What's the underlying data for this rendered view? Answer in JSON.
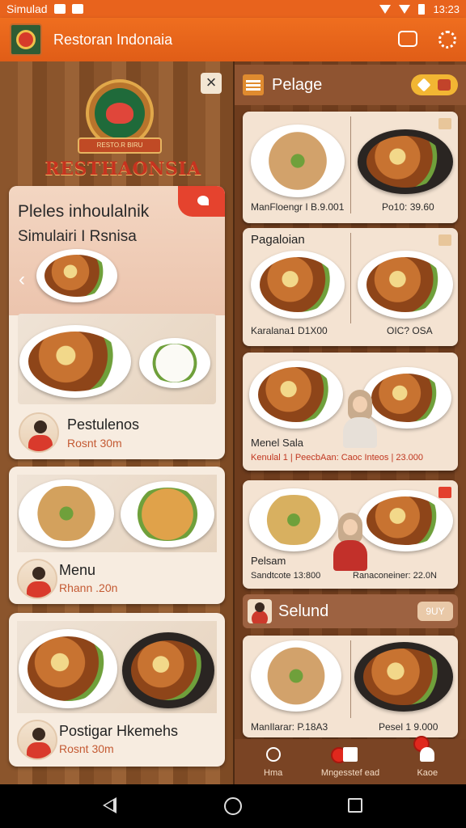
{
  "status_bar": {
    "carrier": "Simulad",
    "time": "13:23"
  },
  "app_bar": {
    "title": "Restoran Indonaia"
  },
  "left_panel": {
    "brand_text": "RESTHAONSIA",
    "emblem_ribbon": "RESTO.R BIRU",
    "promo": {
      "title": "Pleles inhoulalnik",
      "subtitle": "Simulairi I Rsnisa",
      "item_name": "Pestulenos",
      "item_meta": "Rosnt 30m"
    },
    "cards": [
      {
        "name": "Menu",
        "meta": "Rhann .20n"
      },
      {
        "name": "Postigar Hkemehs",
        "meta": "Rosnt 30m"
      }
    ]
  },
  "right_panel": {
    "title": "Pelage",
    "cards": [
      {
        "title": "",
        "left_label": "ManFloengr I B.9.001",
        "right_label": "Po10: 39.60"
      },
      {
        "title": "Pagaloian",
        "left_label": "Karalana1 D1X00",
        "right_label": "OIC? OSA"
      },
      {
        "title": "",
        "left_label": "Menel Sala",
        "left_meta": "Kenulal 1 | PeecbAan: Caoc Inteos | 23.000"
      },
      {
        "title": "Pelsam",
        "left_label": "Sandtcote 13:800",
        "right_label": "Ranaconeiner: 22.0N"
      }
    ],
    "section": {
      "title": "Selund",
      "chip": "9UY"
    },
    "last_card": {
      "left_label": "ManIlarar: P.18A3",
      "right_label": "Pesel 1 9.000"
    }
  },
  "bottom_nav": [
    {
      "label": "Hma",
      "icon": "search-icon"
    },
    {
      "label": "Mngesstef ead",
      "icon": "menu-icon"
    },
    {
      "label": "Kaoe",
      "icon": "user-icon"
    }
  ]
}
